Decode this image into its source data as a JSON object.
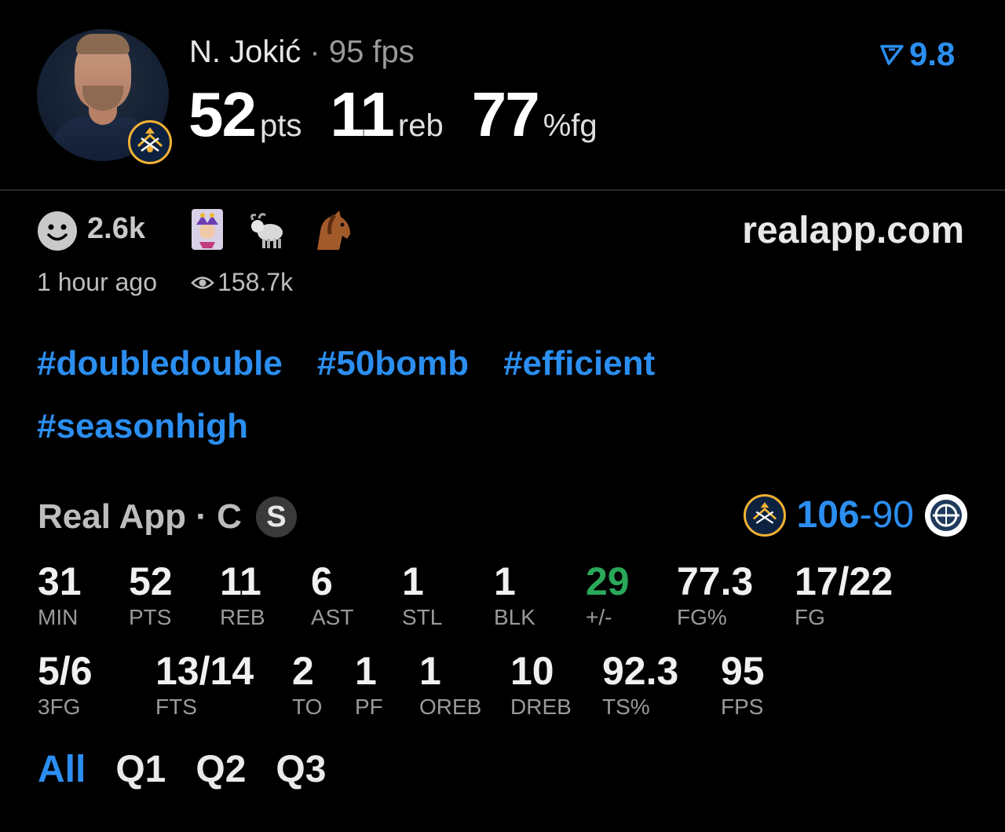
{
  "player": {
    "name": "N. Jokić",
    "separator": "·",
    "fps_label": "95 fps",
    "headline": [
      {
        "value": "52",
        "unit": "pts"
      },
      {
        "value": "11",
        "unit": "reb"
      },
      {
        "value": "77",
        "unit": "%fg"
      }
    ],
    "rating": "9.8"
  },
  "reactions": {
    "count": "2.6k",
    "emojis": [
      "joker-card-icon",
      "goat-icon",
      "horse-icon"
    ],
    "site": "realapp.com",
    "time": "1 hour ago",
    "views": "158.7k"
  },
  "hashtags": [
    "#doubledouble",
    "#50bomb",
    "#efficient",
    "#seasonhigh"
  ],
  "game": {
    "source": "Real App · C",
    "badge": "S",
    "home_score": "106",
    "dash": "-",
    "away_score": "90",
    "colors": {
      "accent": "#2b8ef0",
      "positive": "#2aa85a",
      "nuggets_gold": "#f2b233",
      "nuggets_navy": "#0d2240"
    }
  },
  "box_row1": [
    {
      "value": "31",
      "label": "MIN"
    },
    {
      "value": "52",
      "label": "PTS"
    },
    {
      "value": "11",
      "label": "REB"
    },
    {
      "value": "6",
      "label": "AST"
    },
    {
      "value": "1",
      "label": "STL"
    },
    {
      "value": "1",
      "label": "BLK"
    },
    {
      "value": "29",
      "label": "+/-"
    },
    {
      "value": "77.3",
      "label": "FG%"
    },
    {
      "value": "17/22",
      "label": "FG"
    }
  ],
  "box_row2": [
    {
      "value": "5/6",
      "label": "3FG"
    },
    {
      "value": "13/14",
      "label": "FTS"
    },
    {
      "value": "2",
      "label": "TO"
    },
    {
      "value": "1",
      "label": "PF"
    },
    {
      "value": "1",
      "label": "OREB"
    },
    {
      "value": "10",
      "label": "DREB"
    },
    {
      "value": "92.3",
      "label": "TS%"
    },
    {
      "value": "95",
      "label": "FPS"
    }
  ],
  "quarters": [
    "All",
    "Q1",
    "Q2",
    "Q3"
  ]
}
